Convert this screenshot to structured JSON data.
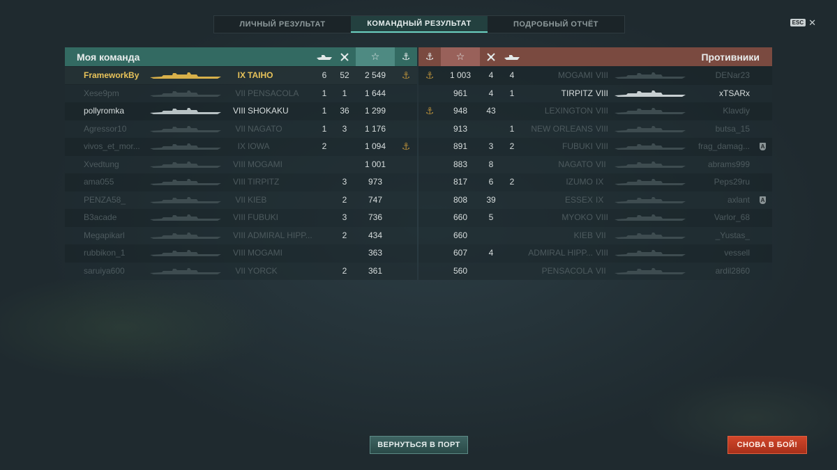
{
  "tabs": [
    {
      "label": "ЛИЧНЫЙ РЕЗУЛЬТАТ",
      "active": false
    },
    {
      "label": "КОМАНДНЫЙ РЕЗУЛЬТАТ",
      "active": true
    },
    {
      "label": "ПОДРОБНЫЙ ОТЧЁТ",
      "active": false
    }
  ],
  "esc": {
    "key": "ESC",
    "close": "✕"
  },
  "my_team": {
    "title": "Моя команда",
    "columns": [
      "ship-kills-icon",
      "planes-kills-icon",
      "star-icon",
      "anchor-icon"
    ],
    "sorted_column": "star-icon",
    "players": [
      {
        "name": "FrameworkBy",
        "tier": "IX",
        "ship": "TAIHO",
        "kills": "6",
        "planes": "52",
        "score": "2 549",
        "anchor": true,
        "alive": true,
        "me": true
      },
      {
        "name": "Xese9pm",
        "tier": "VII",
        "ship": "PENSACOLA",
        "kills": "1",
        "planes": "1",
        "score": "1 644",
        "anchor": false,
        "alive": false
      },
      {
        "name": "pollyromka",
        "tier": "VIII",
        "ship": "SHOKAKU",
        "kills": "1",
        "planes": "36",
        "score": "1 299",
        "anchor": false,
        "alive": true
      },
      {
        "name": "Agressor10",
        "tier": "VII",
        "ship": "NAGATO",
        "kills": "1",
        "planes": "3",
        "score": "1 176",
        "anchor": false,
        "alive": false
      },
      {
        "name": "vivos_et_mor...",
        "tier": "IX",
        "ship": "IOWA",
        "kills": "2",
        "planes": "",
        "score": "1 094",
        "anchor": true,
        "alive": false
      },
      {
        "name": "Xvedtung",
        "tier": "VIII",
        "ship": "MOGAMI",
        "kills": "",
        "planes": "",
        "score": "1 001",
        "anchor": false,
        "alive": false
      },
      {
        "name": "ama055",
        "tier": "VIII",
        "ship": "TIRPITZ",
        "kills": "",
        "planes": "3",
        "score": "973",
        "anchor": false,
        "alive": false
      },
      {
        "name": "PENZA58_",
        "tier": "VII",
        "ship": "KIEB",
        "kills": "",
        "planes": "2",
        "score": "747",
        "anchor": false,
        "alive": false
      },
      {
        "name": "B3acade",
        "tier": "VIII",
        "ship": "FUBUKI",
        "kills": "",
        "planes": "3",
        "score": "736",
        "anchor": false,
        "alive": false
      },
      {
        "name": "Megapikarl",
        "tier": "VIII",
        "ship": "ADMIRAL HIPP...",
        "kills": "",
        "planes": "2",
        "score": "434",
        "anchor": false,
        "alive": false
      },
      {
        "name": "rubbikon_1",
        "tier": "VIII",
        "ship": "MOGAMI",
        "kills": "",
        "planes": "",
        "score": "363",
        "anchor": false,
        "alive": false
      },
      {
        "name": "saruiya600",
        "tier": "VII",
        "ship": "YORCK",
        "kills": "",
        "planes": "2",
        "score": "361",
        "anchor": false,
        "alive": false
      }
    ]
  },
  "enemy_team": {
    "title": "Противники",
    "players": [
      {
        "name": "DENar23",
        "tier": "VIII",
        "ship": "MOGAMI",
        "kills": "4",
        "planes": "4",
        "score": "1 003",
        "anchor": true,
        "alive": false,
        "badge": ""
      },
      {
        "name": "xTSARx",
        "tier": "VIII",
        "ship": "TIRPITZ",
        "kills": "4",
        "planes": "1",
        "score": "961",
        "anchor": false,
        "alive": true,
        "badge": ""
      },
      {
        "name": "Klavdiy",
        "tier": "VIII",
        "ship": "LEXINGTON",
        "kills": "43",
        "planes": "",
        "score": "948",
        "anchor": true,
        "alive": false,
        "badge": ""
      },
      {
        "name": "butsa_15",
        "tier": "VIII",
        "ship": "NEW ORLEANS",
        "kills": "",
        "planes": "1",
        "score": "913",
        "anchor": false,
        "alive": false,
        "badge": ""
      },
      {
        "name": "frag_damag...",
        "tier": "VIII",
        "ship": "FUBUKI",
        "kills": "3",
        "planes": "2",
        "score": "891",
        "anchor": false,
        "alive": false,
        "badge": "A"
      },
      {
        "name": "abrams999",
        "tier": "VII",
        "ship": "NAGATO",
        "kills": "8",
        "planes": "",
        "score": "883",
        "anchor": false,
        "alive": false,
        "badge": ""
      },
      {
        "name": "Peps29ru",
        "tier": "IX",
        "ship": "IZUMO",
        "kills": "6",
        "planes": "2",
        "score": "817",
        "anchor": false,
        "alive": false,
        "badge": ""
      },
      {
        "name": "axlant",
        "tier": "IX",
        "ship": "ESSEX",
        "kills": "39",
        "planes": "",
        "score": "808",
        "anchor": false,
        "alive": false,
        "badge": "A"
      },
      {
        "name": "Varlor_68",
        "tier": "VIII",
        "ship": "MYOKO",
        "kills": "5",
        "planes": "",
        "score": "660",
        "anchor": false,
        "alive": false,
        "badge": ""
      },
      {
        "name": "_Yustas_",
        "tier": "VII",
        "ship": "KIEB",
        "kills": "",
        "planes": "",
        "score": "660",
        "anchor": false,
        "alive": false,
        "badge": ""
      },
      {
        "name": "vessell",
        "tier": "VIII",
        "ship": "ADMIRAL HIPP...",
        "kills": "4",
        "planes": "",
        "score": "607",
        "anchor": false,
        "alive": false,
        "badge": ""
      },
      {
        "name": "ardil2860",
        "tier": "VII",
        "ship": "PENSACOLA",
        "kills": "",
        "planes": "",
        "score": "560",
        "anchor": false,
        "alive": false,
        "badge": ""
      }
    ]
  },
  "buttons": {
    "back_to_port": "ВЕРНУТЬСЯ В ПОРТ",
    "battle_again": "СНОВА В БОЙ!"
  },
  "colors": {
    "my_header": "#336a62",
    "enemy_header": "#7a4a40",
    "highlight": "#e8c35a",
    "battle_button": "#c23c22"
  }
}
